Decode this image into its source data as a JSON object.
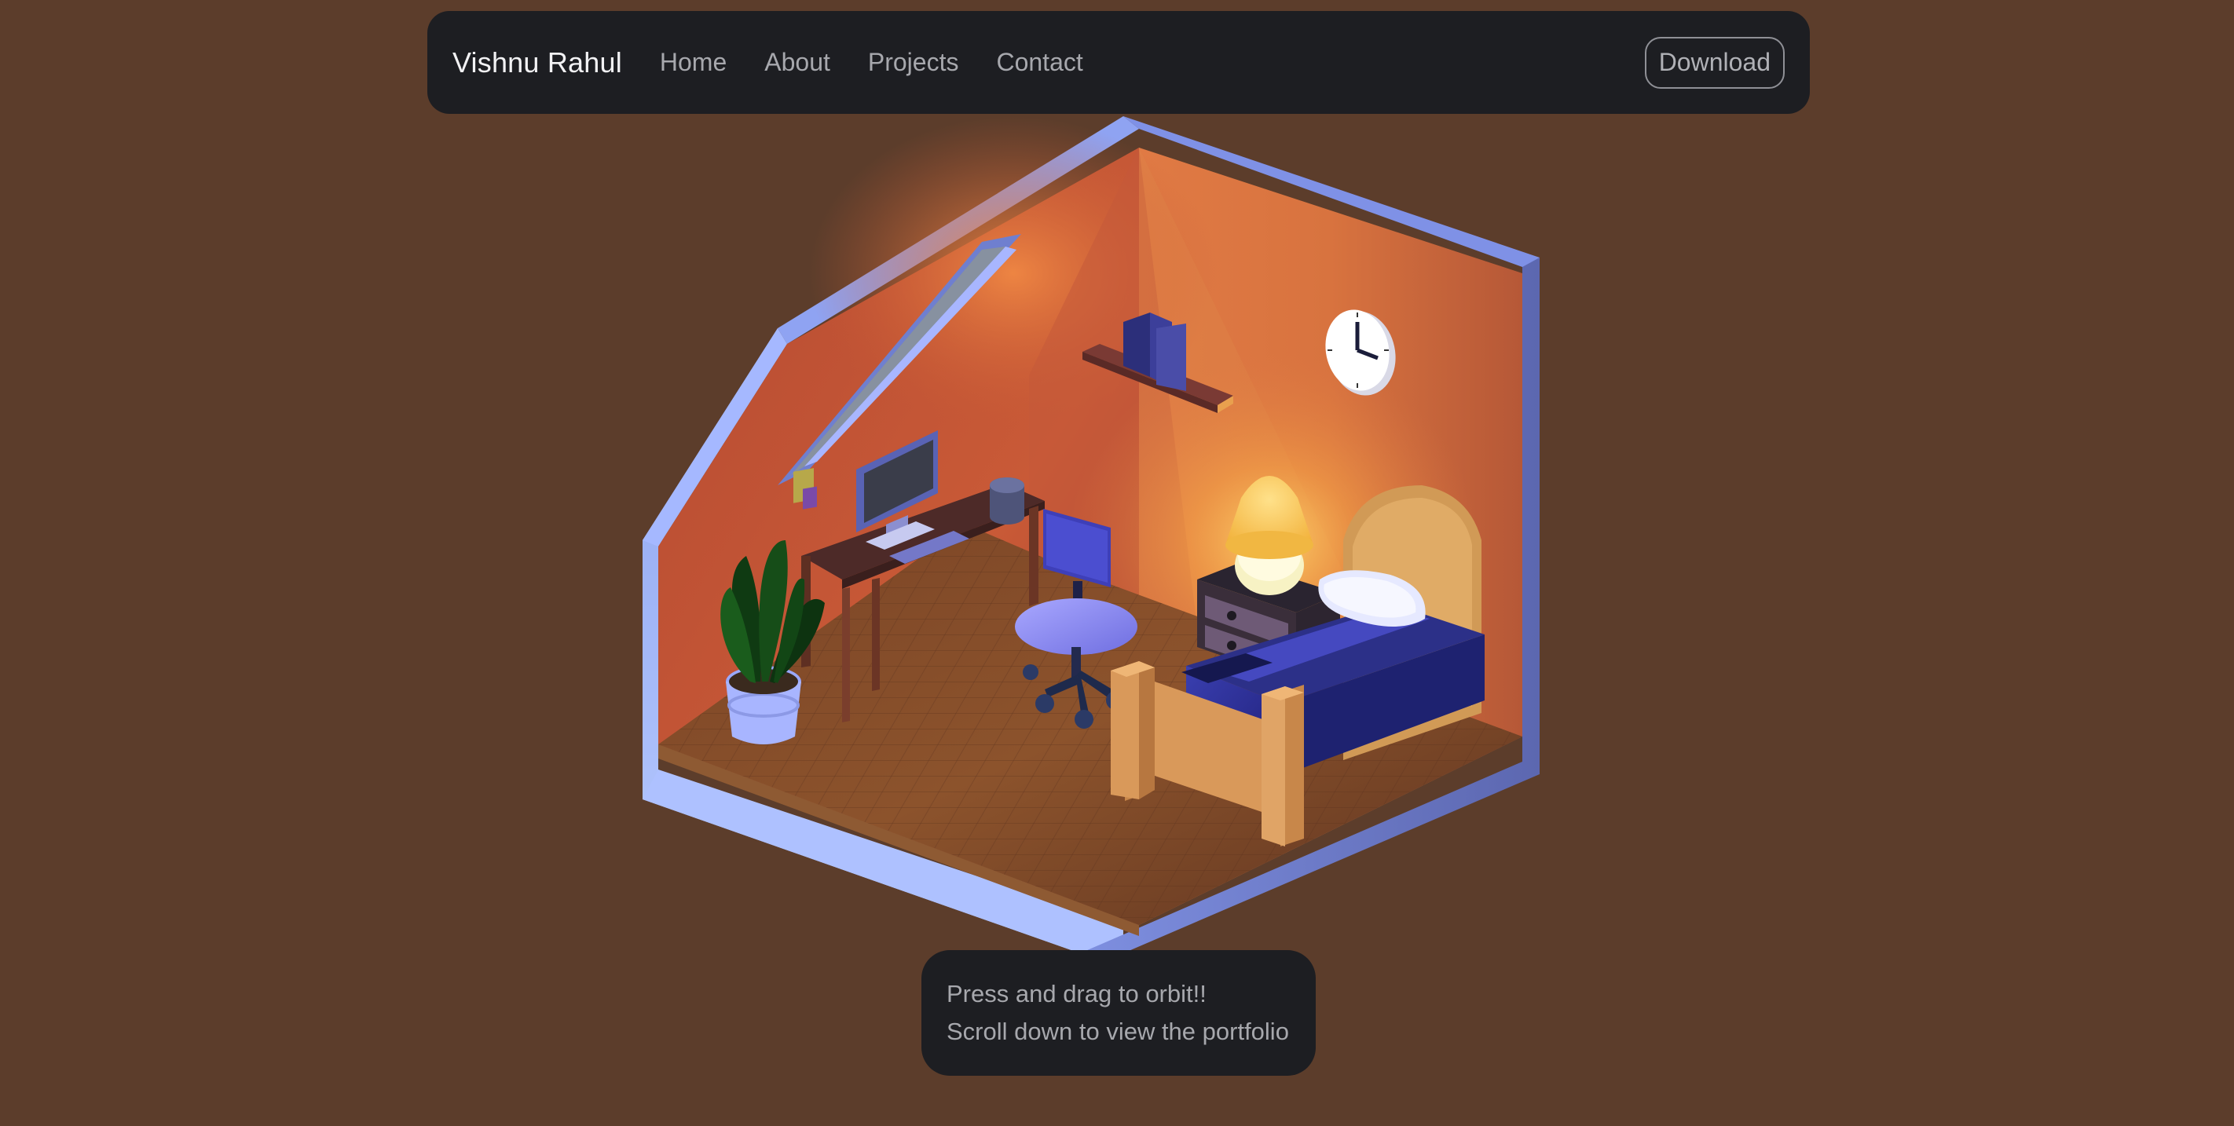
{
  "nav": {
    "brand": "Vishnu Rahul",
    "links": [
      {
        "label": "Home"
      },
      {
        "label": "About"
      },
      {
        "label": "Projects"
      },
      {
        "label": "Contact"
      }
    ],
    "download_label": "Download"
  },
  "hint": {
    "line1": "Press and drag to orbit!!",
    "line2": "Scroll down to view the portfolio"
  },
  "scene": {
    "description_icon": "isometric-bedroom-scene",
    "colors": {
      "background": "#5c3d2b",
      "panel": "#1d1e22",
      "wall_trim": "#9db0f4",
      "wall_warm": "#d2683e",
      "floor": "#6b3f22"
    }
  }
}
